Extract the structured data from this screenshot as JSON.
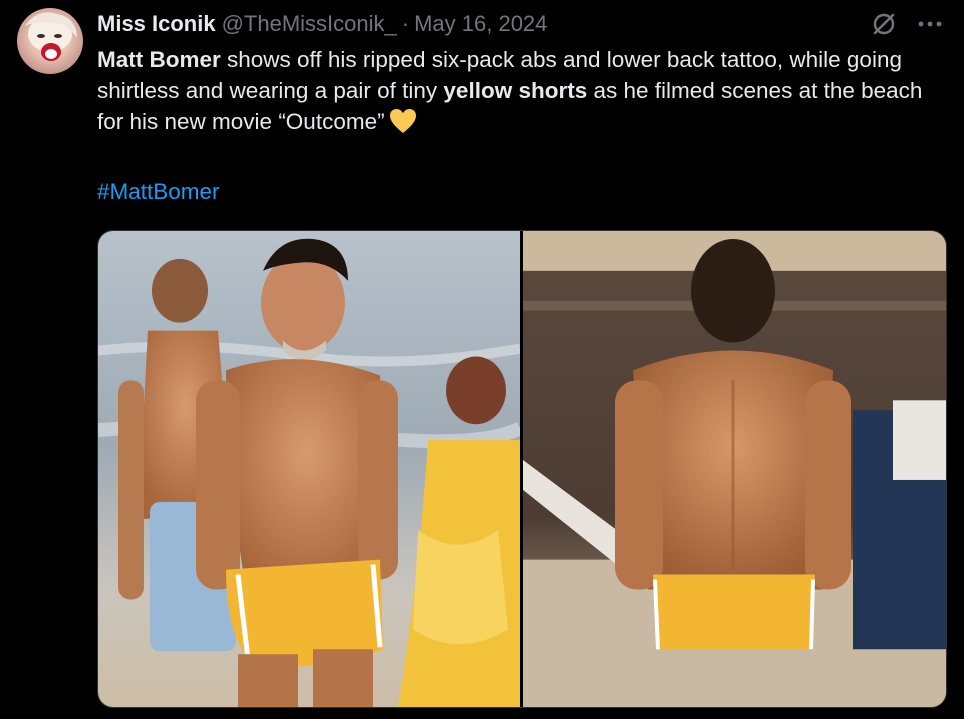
{
  "author": {
    "display_name": "Miss Iconik",
    "handle": "@TheMissIconik_",
    "separator": "·",
    "date": "May 16, 2024",
    "avatar_icon": "avatar-photo"
  },
  "header_icons": [
    "grok-icon",
    "more-icon"
  ],
  "tweet": {
    "segments": [
      {
        "text": "Matt Bomer",
        "bold": true
      },
      {
        "text": " shows off his ripped six-pack abs and lower back tattoo, while going shirtless and wearing a pair of tiny ",
        "bold": false
      },
      {
        "text": "yellow shorts",
        "bold": true
      },
      {
        "text": " as he filmed scenes at the beach for his new movie “Outcome”",
        "bold": false
      }
    ],
    "emoji": "yellow-heart-icon",
    "hashtag": "#MattBomer"
  },
  "media": {
    "count": 2,
    "items": [
      "photo-left",
      "photo-right"
    ]
  },
  "colors": {
    "background": "#000000",
    "text_primary": "#e7e9ea",
    "text_secondary": "#71767b",
    "link": "#1d9bf0",
    "heart": "#fcc954",
    "shorts": "#f2b632"
  }
}
